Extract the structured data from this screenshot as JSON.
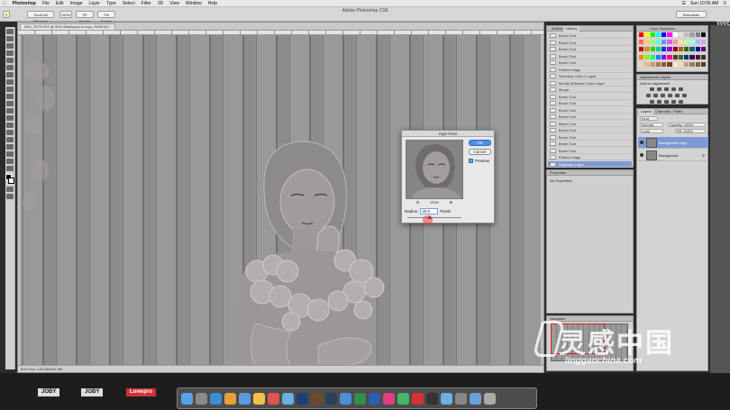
{
  "menubar": {
    "app": "Photoshop",
    "items": [
      "File",
      "Edit",
      "Image",
      "Layer",
      "Type",
      "Select",
      "Filter",
      "3D",
      "View",
      "Window",
      "Help"
    ],
    "clock": "Sun 10:56 AM"
  },
  "options": {
    "app_title": "Adobe Photoshop CS6",
    "btn1": "Scroll All Windows",
    "btn2": "100%",
    "btn3": "Fit Screen",
    "btn4": "Fill Screen",
    "workspace": "Essentials"
  },
  "document": {
    "tab_title": "IMG_7875.CR2 @ 50% (Background copy, RGB/16) *",
    "status": "50%   Doc: 132.5M/264.9M"
  },
  "dialog": {
    "title": "High Pass",
    "ok": "OK",
    "cancel": "Cancel",
    "preview_label": "Preview",
    "zoom_value": "100%",
    "radius_label": "Radius:",
    "radius_value": "40.0",
    "radius_unit": "Pixels",
    "preview_checked": true
  },
  "history": {
    "tabs": [
      "Actions",
      "History"
    ],
    "rows": [
      "Brush Tool",
      "Brush Tool",
      "Brush Tool",
      "Brush Tool",
      "Brush Tool",
      "Flatten Image",
      "Selective Color 1 Layer",
      "Modify Selective Color Layer",
      "Merge",
      "Brush Tool",
      "Brush Tool",
      "Brush Tool",
      "Brush Tool",
      "Brush Tool",
      "Brush Tool",
      "Brush Tool",
      "Brush Tool",
      "Brush Tool",
      "Flatten Image",
      "Duplicate Layer"
    ],
    "selected_index": 19
  },
  "properties": {
    "tab": "Properties",
    "empty": "No Properties"
  },
  "navigator": {
    "tab": "Navigator"
  },
  "swatches": {
    "tabs": "Color   Swatches",
    "colors": [
      "#ff0000",
      "#ffff00",
      "#00ff00",
      "#00ffff",
      "#0000ff",
      "#ff00ff",
      "#ffffff",
      "#e0e0e0",
      "#c0c0c0",
      "#a0a0a0",
      "#808080",
      "#000000",
      "#ff6666",
      "#ffcc66",
      "#99ff66",
      "#66ffcc",
      "#6699ff",
      "#cc66ff",
      "#ff9999",
      "#ffe0a0",
      "#c0ffa0",
      "#a0ffe0",
      "#a0c0ff",
      "#e0a0ff",
      "#cc0000",
      "#cc9900",
      "#33cc00",
      "#00cc99",
      "#0033cc",
      "#9900cc",
      "#990000",
      "#996600",
      "#336600",
      "#006666",
      "#000099",
      "#660066",
      "#ff8800",
      "#88ff00",
      "#00ff88",
      "#0088ff",
      "#8800ff",
      "#ff0088",
      "#663300",
      "#336633",
      "#003366",
      "#330066",
      "#660033",
      "#333333",
      "#f5d0b0",
      "#e8b890",
      "#d09870",
      "#b07850",
      "#905838",
      "#704020",
      "#ffe8d0",
      "#ffd8b0",
      "#c8a080",
      "#a08060",
      "#806040",
      "#604020"
    ]
  },
  "adjustments": {
    "tabs": "Adjustments   Styles",
    "subtitle": "Add an adjustment"
  },
  "layers": {
    "tabs": [
      "Layers",
      "Channels",
      "Paths"
    ],
    "kind": "Kind",
    "blend": "Normal",
    "opacity": "Opacity: 100%",
    "lock": "Lock:",
    "fill": "Fill: 100%",
    "items": [
      "Background copy",
      "Background"
    ],
    "selected_index": 0
  },
  "brands": [
    "JOBY",
    "JOBY",
    "Lowepro"
  ],
  "dock_apps": [
    "Finder",
    "Launchpad",
    "Safari",
    "Chrome",
    "Mail",
    "Photos",
    "Calendar",
    "Preview",
    "Photoshop",
    "Bridge",
    "Lightroom",
    "Finder",
    "Excel",
    "Word",
    "iTunes",
    "Messages",
    "Weibo",
    "Terminal",
    "Preview",
    "Screenshot",
    "Folder",
    "Trash"
  ],
  "watermark": {
    "title": "灵感中国",
    "sub": "lingganchina.com"
  },
  "side_text": "Web"
}
